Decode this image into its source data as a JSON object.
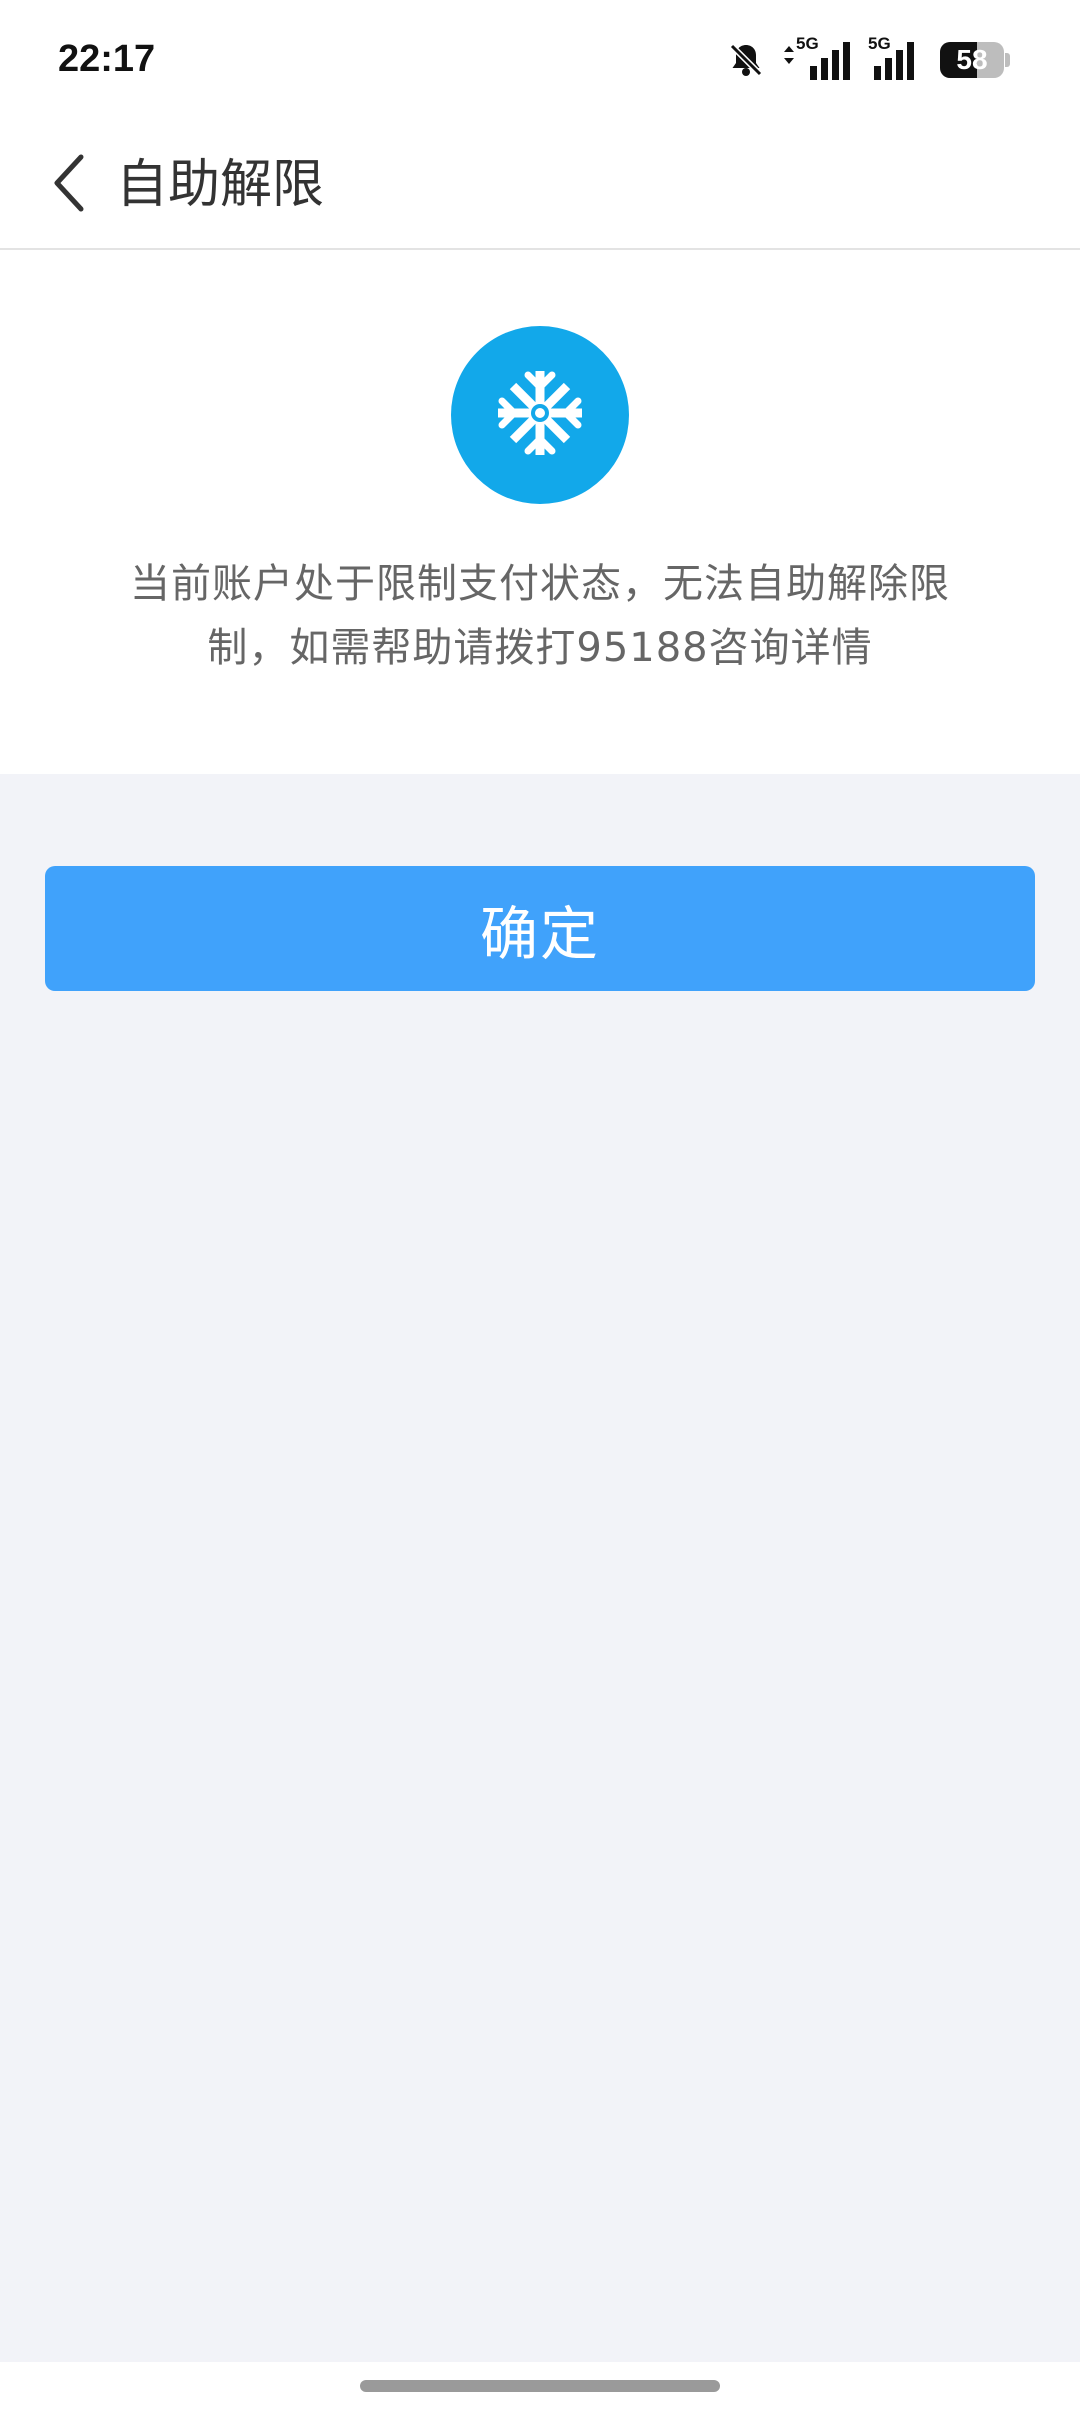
{
  "status_bar": {
    "time": "22:17",
    "network_1": "5G",
    "network_2": "5G",
    "battery_level": "58",
    "icons": [
      "bell-muted-icon",
      "data-arrows-icon",
      "signal-icon",
      "signal-icon",
      "battery-icon"
    ]
  },
  "nav": {
    "back_icon": "chevron-left-icon",
    "title": "自助解限"
  },
  "content": {
    "status_icon": "snowflake-icon",
    "icon_color": "#12a8ea",
    "message_line1": "当前账户处于限制支付状态，无法自助解除限",
    "message_line2": "制，如需帮助请拨打95188咨询详情"
  },
  "actions": {
    "confirm_label": "确定",
    "confirm_color": "#40a2fb"
  }
}
